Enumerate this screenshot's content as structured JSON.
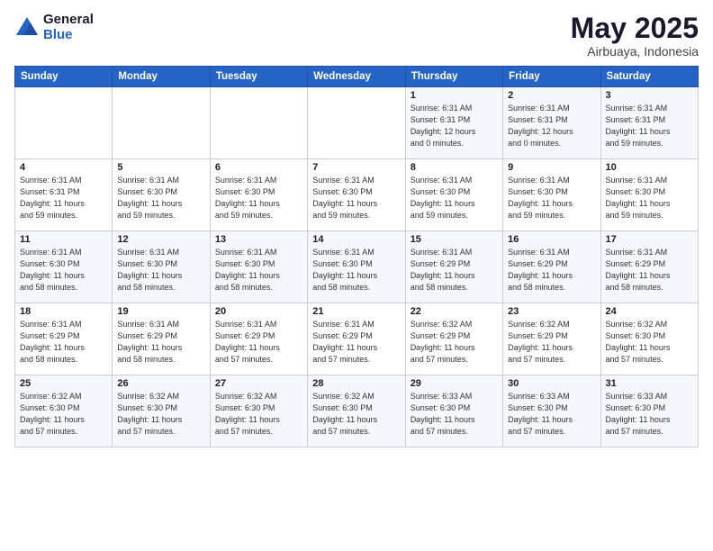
{
  "header": {
    "logo_general": "General",
    "logo_blue": "Blue",
    "month": "May 2025",
    "location": "Airbuaya, Indonesia"
  },
  "weekdays": [
    "Sunday",
    "Monday",
    "Tuesday",
    "Wednesday",
    "Thursday",
    "Friday",
    "Saturday"
  ],
  "weeks": [
    [
      {
        "day": "",
        "info": ""
      },
      {
        "day": "",
        "info": ""
      },
      {
        "day": "",
        "info": ""
      },
      {
        "day": "",
        "info": ""
      },
      {
        "day": "1",
        "info": "Sunrise: 6:31 AM\nSunset: 6:31 PM\nDaylight: 12 hours\nand 0 minutes."
      },
      {
        "day": "2",
        "info": "Sunrise: 6:31 AM\nSunset: 6:31 PM\nDaylight: 12 hours\nand 0 minutes."
      },
      {
        "day": "3",
        "info": "Sunrise: 6:31 AM\nSunset: 6:31 PM\nDaylight: 11 hours\nand 59 minutes."
      }
    ],
    [
      {
        "day": "4",
        "info": "Sunrise: 6:31 AM\nSunset: 6:31 PM\nDaylight: 11 hours\nand 59 minutes."
      },
      {
        "day": "5",
        "info": "Sunrise: 6:31 AM\nSunset: 6:30 PM\nDaylight: 11 hours\nand 59 minutes."
      },
      {
        "day": "6",
        "info": "Sunrise: 6:31 AM\nSunset: 6:30 PM\nDaylight: 11 hours\nand 59 minutes."
      },
      {
        "day": "7",
        "info": "Sunrise: 6:31 AM\nSunset: 6:30 PM\nDaylight: 11 hours\nand 59 minutes."
      },
      {
        "day": "8",
        "info": "Sunrise: 6:31 AM\nSunset: 6:30 PM\nDaylight: 11 hours\nand 59 minutes."
      },
      {
        "day": "9",
        "info": "Sunrise: 6:31 AM\nSunset: 6:30 PM\nDaylight: 11 hours\nand 59 minutes."
      },
      {
        "day": "10",
        "info": "Sunrise: 6:31 AM\nSunset: 6:30 PM\nDaylight: 11 hours\nand 59 minutes."
      }
    ],
    [
      {
        "day": "11",
        "info": "Sunrise: 6:31 AM\nSunset: 6:30 PM\nDaylight: 11 hours\nand 58 minutes."
      },
      {
        "day": "12",
        "info": "Sunrise: 6:31 AM\nSunset: 6:30 PM\nDaylight: 11 hours\nand 58 minutes."
      },
      {
        "day": "13",
        "info": "Sunrise: 6:31 AM\nSunset: 6:30 PM\nDaylight: 11 hours\nand 58 minutes."
      },
      {
        "day": "14",
        "info": "Sunrise: 6:31 AM\nSunset: 6:30 PM\nDaylight: 11 hours\nand 58 minutes."
      },
      {
        "day": "15",
        "info": "Sunrise: 6:31 AM\nSunset: 6:29 PM\nDaylight: 11 hours\nand 58 minutes."
      },
      {
        "day": "16",
        "info": "Sunrise: 6:31 AM\nSunset: 6:29 PM\nDaylight: 11 hours\nand 58 minutes."
      },
      {
        "day": "17",
        "info": "Sunrise: 6:31 AM\nSunset: 6:29 PM\nDaylight: 11 hours\nand 58 minutes."
      }
    ],
    [
      {
        "day": "18",
        "info": "Sunrise: 6:31 AM\nSunset: 6:29 PM\nDaylight: 11 hours\nand 58 minutes."
      },
      {
        "day": "19",
        "info": "Sunrise: 6:31 AM\nSunset: 6:29 PM\nDaylight: 11 hours\nand 58 minutes."
      },
      {
        "day": "20",
        "info": "Sunrise: 6:31 AM\nSunset: 6:29 PM\nDaylight: 11 hours\nand 57 minutes."
      },
      {
        "day": "21",
        "info": "Sunrise: 6:31 AM\nSunset: 6:29 PM\nDaylight: 11 hours\nand 57 minutes."
      },
      {
        "day": "22",
        "info": "Sunrise: 6:32 AM\nSunset: 6:29 PM\nDaylight: 11 hours\nand 57 minutes."
      },
      {
        "day": "23",
        "info": "Sunrise: 6:32 AM\nSunset: 6:29 PM\nDaylight: 11 hours\nand 57 minutes."
      },
      {
        "day": "24",
        "info": "Sunrise: 6:32 AM\nSunset: 6:30 PM\nDaylight: 11 hours\nand 57 minutes."
      }
    ],
    [
      {
        "day": "25",
        "info": "Sunrise: 6:32 AM\nSunset: 6:30 PM\nDaylight: 11 hours\nand 57 minutes."
      },
      {
        "day": "26",
        "info": "Sunrise: 6:32 AM\nSunset: 6:30 PM\nDaylight: 11 hours\nand 57 minutes."
      },
      {
        "day": "27",
        "info": "Sunrise: 6:32 AM\nSunset: 6:30 PM\nDaylight: 11 hours\nand 57 minutes."
      },
      {
        "day": "28",
        "info": "Sunrise: 6:32 AM\nSunset: 6:30 PM\nDaylight: 11 hours\nand 57 minutes."
      },
      {
        "day": "29",
        "info": "Sunrise: 6:33 AM\nSunset: 6:30 PM\nDaylight: 11 hours\nand 57 minutes."
      },
      {
        "day": "30",
        "info": "Sunrise: 6:33 AM\nSunset: 6:30 PM\nDaylight: 11 hours\nand 57 minutes."
      },
      {
        "day": "31",
        "info": "Sunrise: 6:33 AM\nSunset: 6:30 PM\nDaylight: 11 hours\nand 57 minutes."
      }
    ]
  ]
}
